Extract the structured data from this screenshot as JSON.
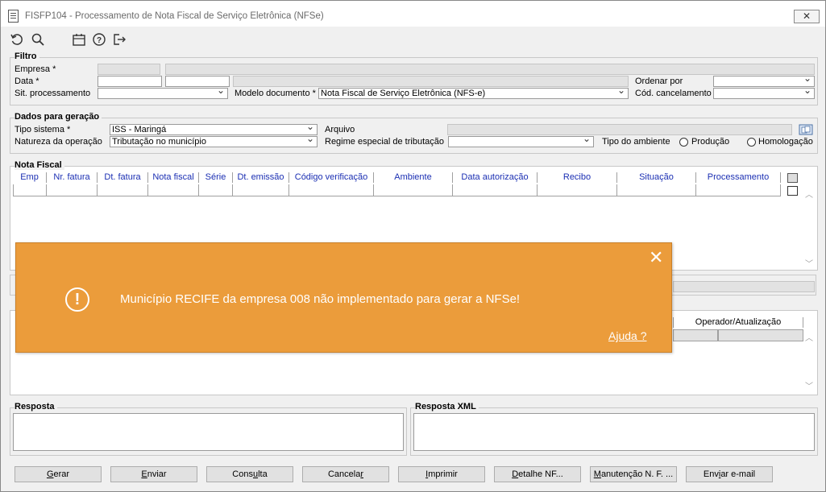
{
  "window": {
    "title": "FISFP104 - Processamento de Nota Fiscal de Serviço Eletrônica (NFSe)",
    "close_glyph": "✕"
  },
  "toolbar": {
    "icons": [
      "undo-icon",
      "search-icon",
      "calendar-icon",
      "help-icon",
      "exit-icon"
    ]
  },
  "filtro": {
    "legend": "Filtro",
    "empresa_label": "Empresa *",
    "data_label": "Data *",
    "sit_processamento_label": "Sit. processamento",
    "modelo_documento_label": "Modelo documento *",
    "modelo_documento_value": "Nota Fiscal de Serviço Eletrônica (NFS-e)",
    "ordenar_por_label": "Ordenar por",
    "cod_cancelamento_label": "Cód. cancelamento"
  },
  "dados_geracao": {
    "legend": "Dados para geração",
    "tipo_sistema_label": "Tipo sistema *",
    "tipo_sistema_value": "ISS - Maringá",
    "natureza_label": "Natureza da operação",
    "natureza_value": "Tributação no município",
    "arquivo_label": "Arquivo",
    "regime_label": "Regime especial de tributação",
    "tipo_ambiente_label": "Tipo do ambiente",
    "producao_label": "Produção",
    "homologacao_label": "Homologação"
  },
  "nota_fiscal": {
    "legend": "Nota Fiscal",
    "columns": [
      "Emp",
      "Nr. fatura",
      "Dt. fatura",
      "Nota fiscal",
      "Série",
      "Dt. emissão",
      "Código verificação",
      "Ambiente",
      "Data autorização",
      "Recibo",
      "Situação",
      "Processamento"
    ]
  },
  "historico": {
    "operador_header": "Operador/Atualização"
  },
  "resposta": {
    "legend": "Resposta"
  },
  "resposta_xml": {
    "legend": "Resposta XML"
  },
  "buttons": {
    "gerar": [
      "G",
      "erar"
    ],
    "enviar": [
      "E",
      "nviar"
    ],
    "consulta": [
      "Cons",
      "u",
      "lta"
    ],
    "cancelar": [
      "Cancela",
      "r",
      ""
    ],
    "imprimir": [
      "I",
      "mprimir"
    ],
    "detalhe": [
      "D",
      "etalhe NF..."
    ],
    "manutencao": [
      "M",
      "anutenção N. F. ..."
    ],
    "email": [
      "Env",
      "i",
      "ar e-mail"
    ]
  },
  "toast": {
    "message": "Município RECIFE da empresa 008 não implementado para gerar a NFSe!",
    "help_link": "Ajuda ?",
    "icon_glyph": "!",
    "close_glyph": "✕",
    "color": "#eb9c3b"
  }
}
